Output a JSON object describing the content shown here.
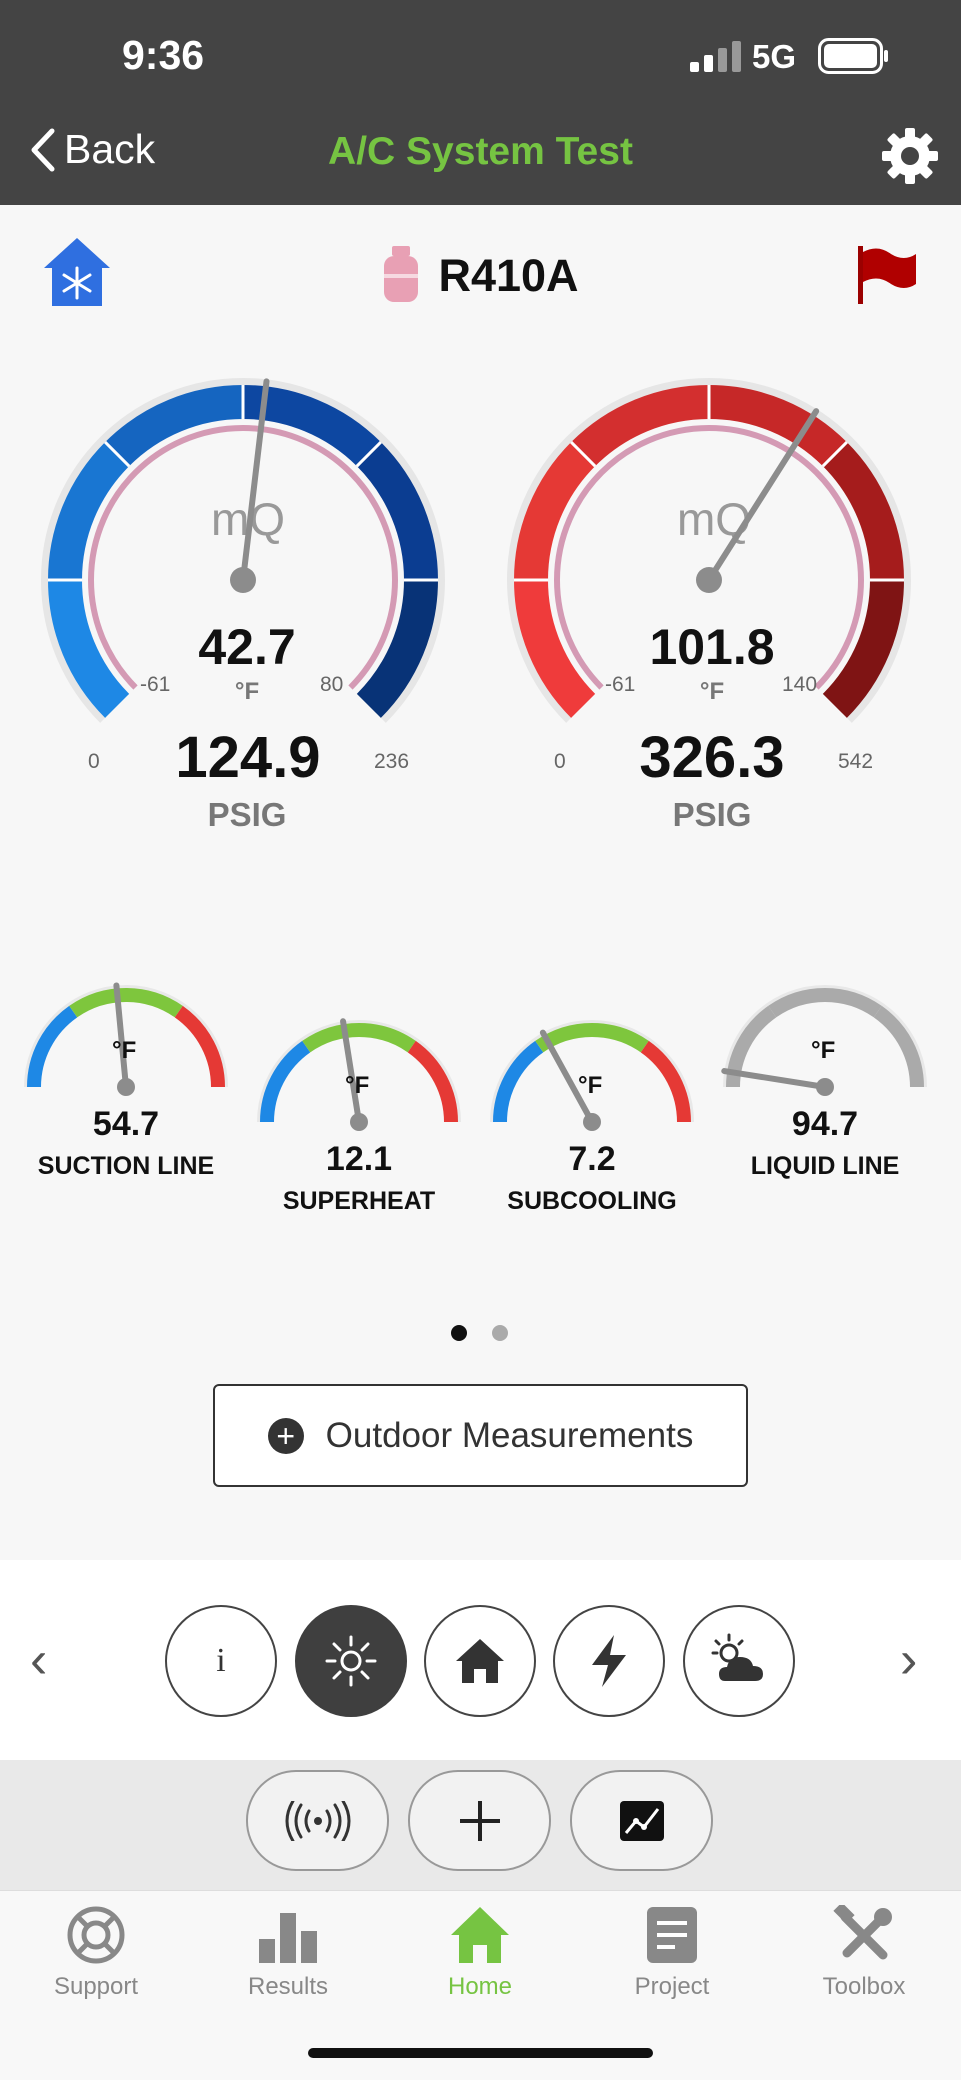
{
  "status_bar": {
    "time": "9:36",
    "network": "5G"
  },
  "nav": {
    "back_label": "Back",
    "title": "A/C System Test"
  },
  "refrigerant": "R410A",
  "logo_text": "mQ",
  "low_side": {
    "temp": "42.7",
    "temp_unit": "°F",
    "temp_min": "-61",
    "temp_max": "80",
    "pressure": "124.9",
    "pressure_unit": "PSIG",
    "press_min": "0",
    "press_max": "236",
    "needle_fraction": 0.525
  },
  "high_side": {
    "temp": "101.8",
    "temp_unit": "°F",
    "temp_min": "-61",
    "temp_max": "140",
    "pressure": "326.3",
    "pressure_unit": "PSIG",
    "press_min": "0",
    "press_max": "542",
    "needle_fraction": 0.62
  },
  "small_gauges": [
    {
      "label": "SUCTION LINE",
      "value": "54.7",
      "unit": "°F",
      "needle_fraction": 0.47
    },
    {
      "label": "SUPERHEAT",
      "value": "12.1",
      "unit": "°F",
      "needle_fraction": 0.45
    },
    {
      "label": "SUBCOOLING",
      "value": "7.2",
      "unit": "°F",
      "needle_fraction": 0.34
    },
    {
      "label": "LIQUID LINE",
      "value": "94.7",
      "unit": "°F",
      "needle_fraction": 0.05
    }
  ],
  "page_dots": {
    "count": 2,
    "active": 0
  },
  "outdoor_button": "Outdoor Measurements",
  "category_buttons": [
    "info-icon",
    "sun-icon",
    "house-icon",
    "lightning-icon",
    "cloud-sun-icon"
  ],
  "action_buttons": [
    "wireless-icon",
    "plus-icon",
    "chart-icon"
  ],
  "tabs": [
    {
      "label": "Support",
      "icon": "lifebuoy-icon"
    },
    {
      "label": "Results",
      "icon": "bar-chart-icon"
    },
    {
      "label": "Home",
      "icon": "home-icon"
    },
    {
      "label": "Project",
      "icon": "document-icon"
    },
    {
      "label": "Toolbox",
      "icon": "tools-icon"
    }
  ],
  "colors": {
    "accent": "#76c442",
    "low_side": "#1565c0",
    "high_side": "#c62828",
    "nav_bg": "#444444"
  }
}
